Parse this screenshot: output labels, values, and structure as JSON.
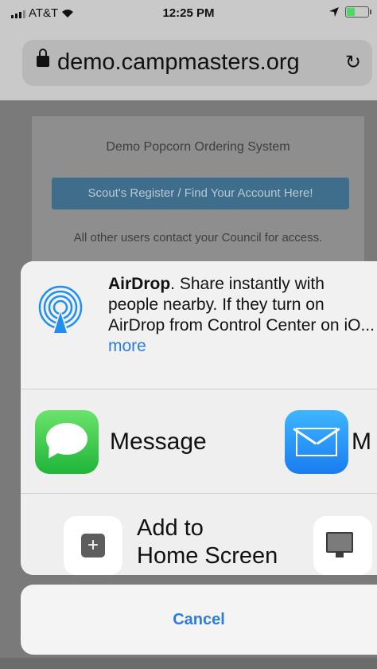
{
  "status_bar": {
    "carrier": "AT&T",
    "time": "12:25 PM",
    "wifi_icon": "wifi-icon",
    "location_icon": "location-arrow-icon",
    "battery_level": 0.35,
    "battery_color": "#4cd964"
  },
  "browser": {
    "url": "demo.campmasters.org",
    "lock_icon": "lock-icon",
    "reload_icon": "reload-icon"
  },
  "page": {
    "title": "Demo Popcorn Ordering System",
    "register_button": "Scout's Register / Find Your Account Here!",
    "access_note": "All other users contact your Council for access."
  },
  "share_sheet": {
    "airdrop": {
      "title": "AirDrop",
      "description": ". Share instantly with people nearby. If they turn on AirDrop from Control Center on iO...",
      "more_link": "more",
      "icon": "airdrop-icon"
    },
    "apps": [
      {
        "label": "Message",
        "icon": "messages-icon"
      },
      {
        "label": "M",
        "icon": "mail-icon"
      }
    ],
    "actions": [
      {
        "label_line1": "Add to",
        "label_line2": "Home Screen",
        "icon": "add-to-home-icon"
      },
      {
        "label": "",
        "icon": "desktop-site-icon"
      }
    ],
    "cancel_label": "Cancel",
    "accent_color": "#2a7de1"
  }
}
